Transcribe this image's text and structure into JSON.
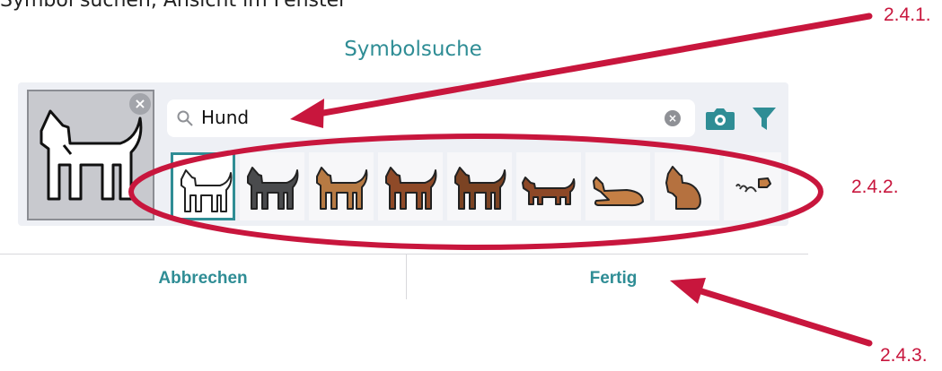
{
  "top_text": "Symbol suchen, Ansicht im Fenster",
  "dialog": {
    "title": "Symbolsuche",
    "search_value": "Hund",
    "cancel_label": "Abbrechen",
    "done_label": "Fertig",
    "results_count_visible": 9
  },
  "callouts": {
    "c1": "2.4.1.",
    "c2": "2.4.2.",
    "c3": "2.4.3."
  },
  "colors": {
    "accent": "#2f8d95",
    "annotation": "#c8163d"
  },
  "icons": {
    "preview": "dog-icon",
    "close": "close-icon",
    "search": "search-icon",
    "clear": "clear-icon",
    "camera": "camera-icon",
    "filter": "filter-icon",
    "sound": "sound-icon"
  }
}
